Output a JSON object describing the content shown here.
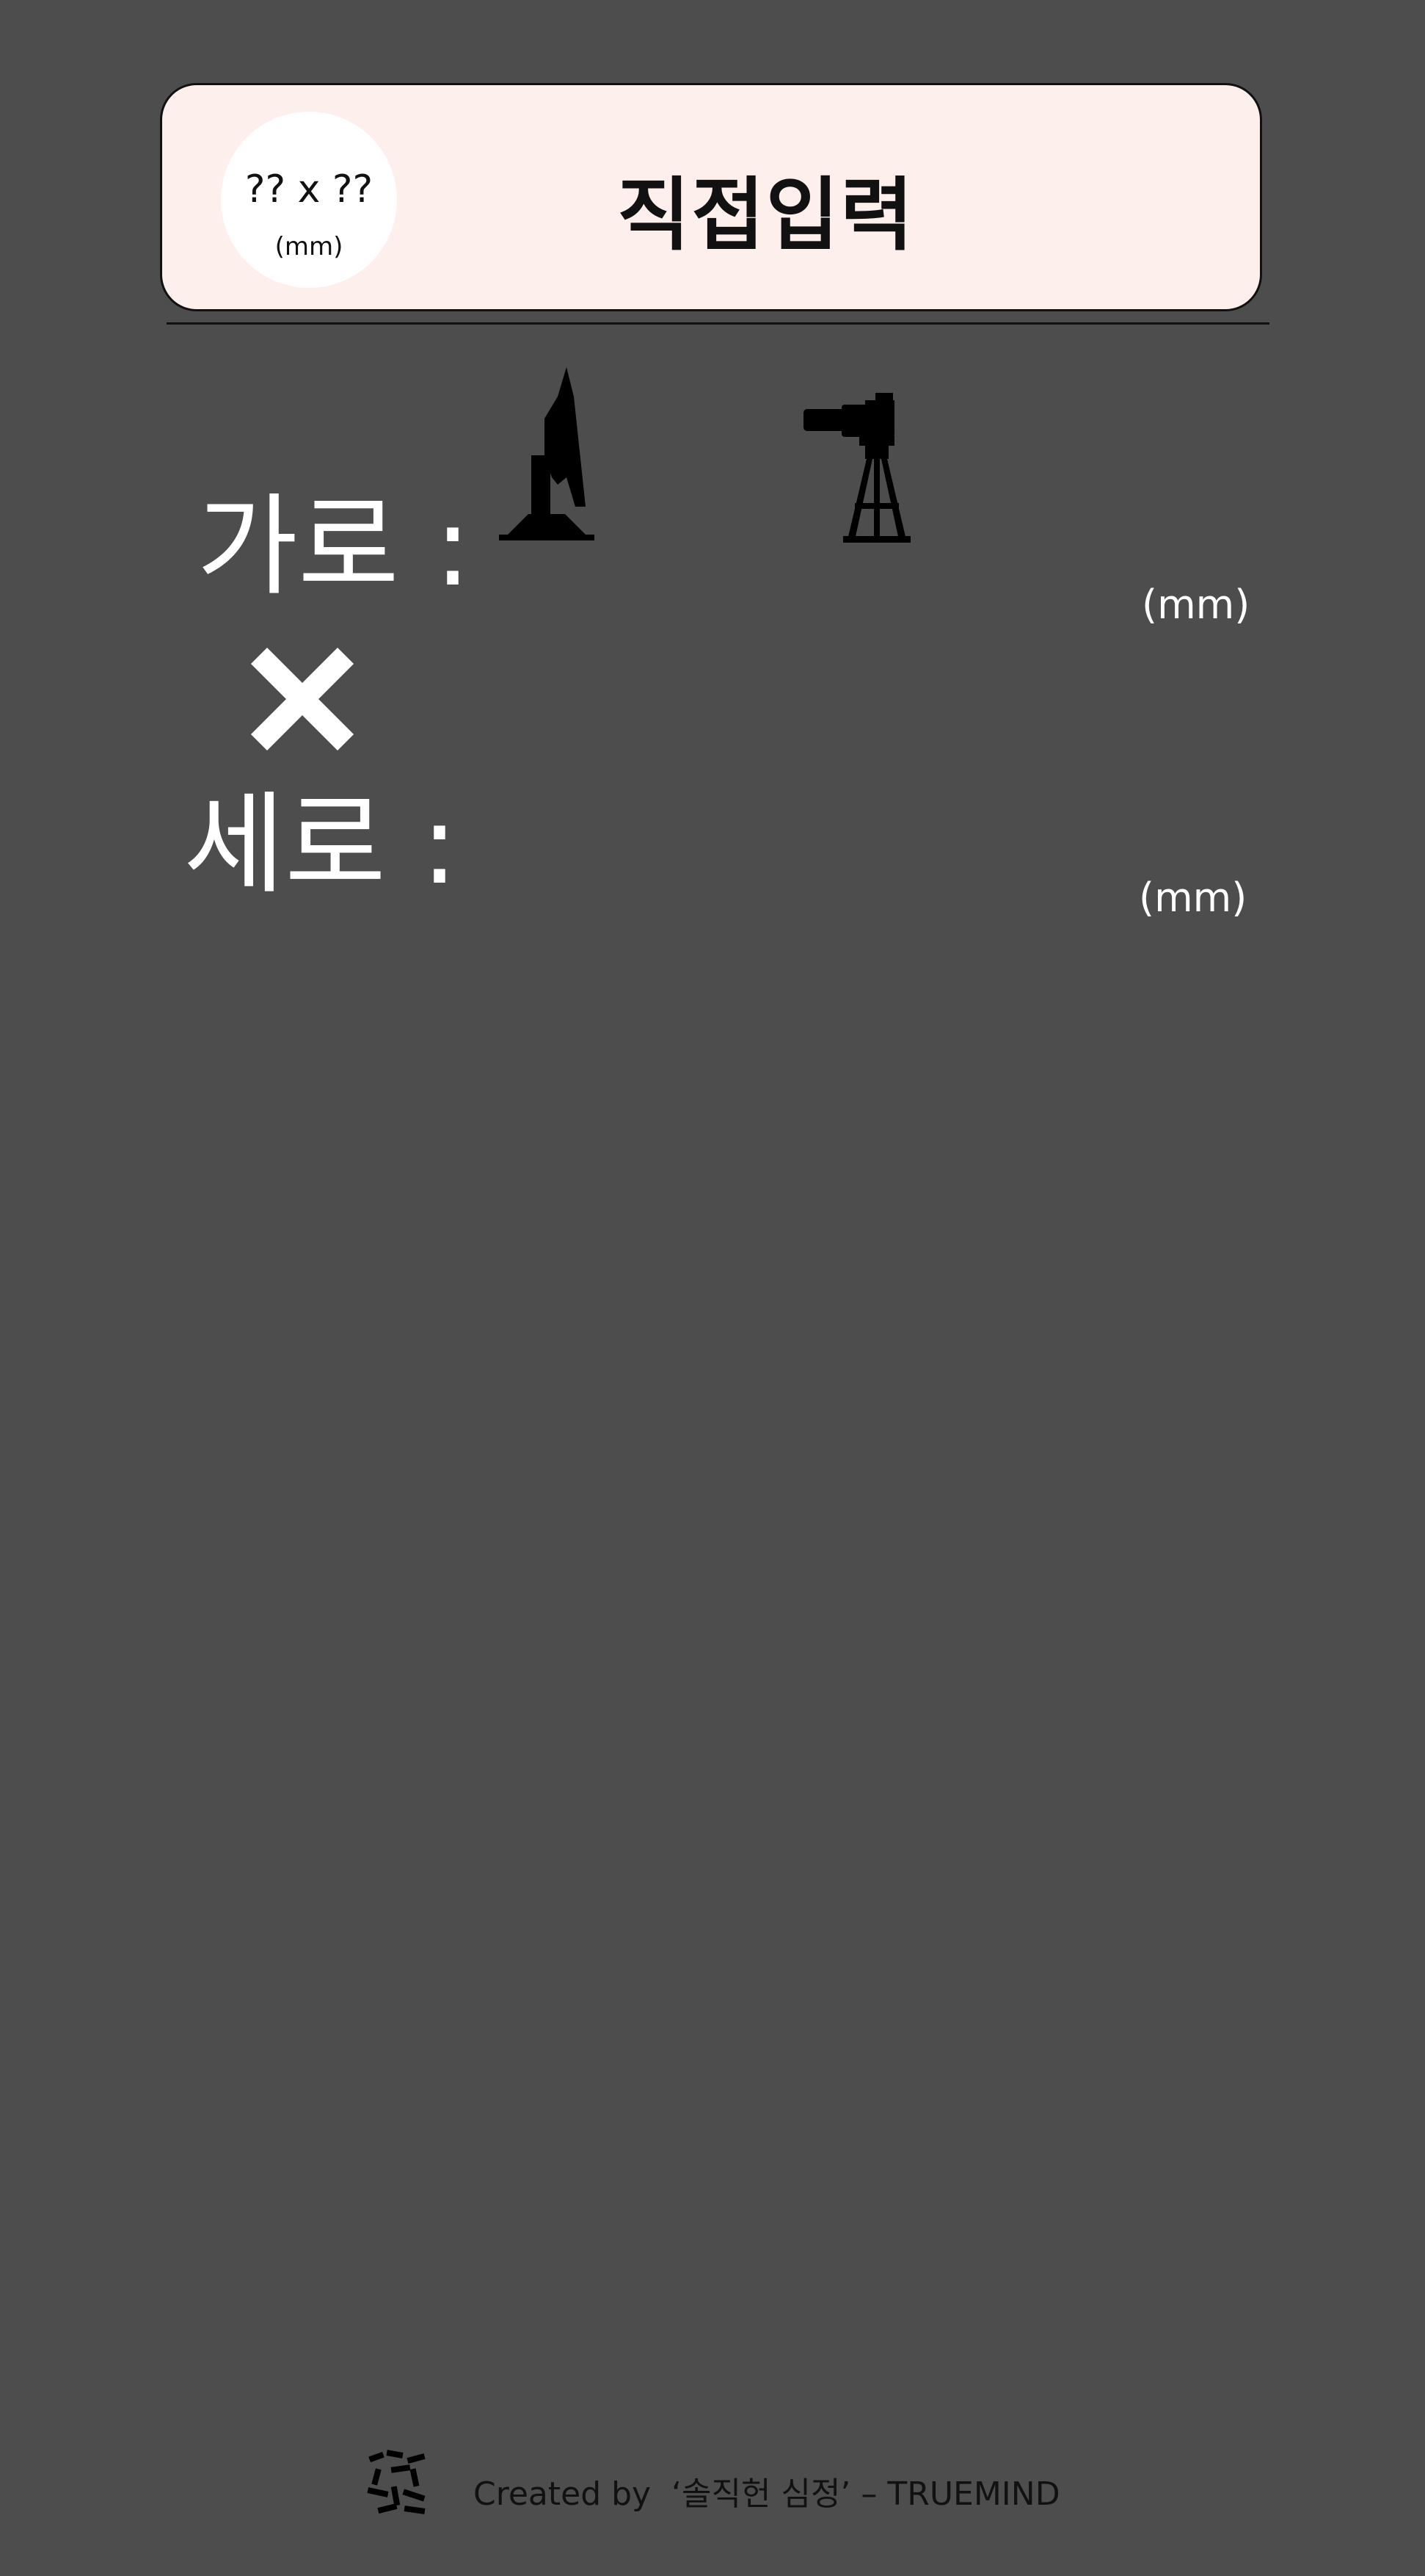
{
  "header": {
    "badge_dims": "?? x ??",
    "badge_unit": "(mm)",
    "title": "직접입력"
  },
  "fields": {
    "width_label": "가로 :",
    "width_unit": "(mm)",
    "height_label": "세로 :",
    "height_unit": "(mm)"
  },
  "icons": {
    "monitor_stand": "monitor-stand-icon",
    "camera_tripod": "camera-tripod-icon",
    "multiply": "multiply-icon",
    "logo": "brand-logo-icon"
  },
  "footer": {
    "credit": "Created by  ‘솔직헌 심정’ – TRUEMIND"
  },
  "colors": {
    "background": "#4d4d4d",
    "card": "#fdf0ec",
    "text_light": "#ffffff",
    "text_dark": "#111111"
  }
}
